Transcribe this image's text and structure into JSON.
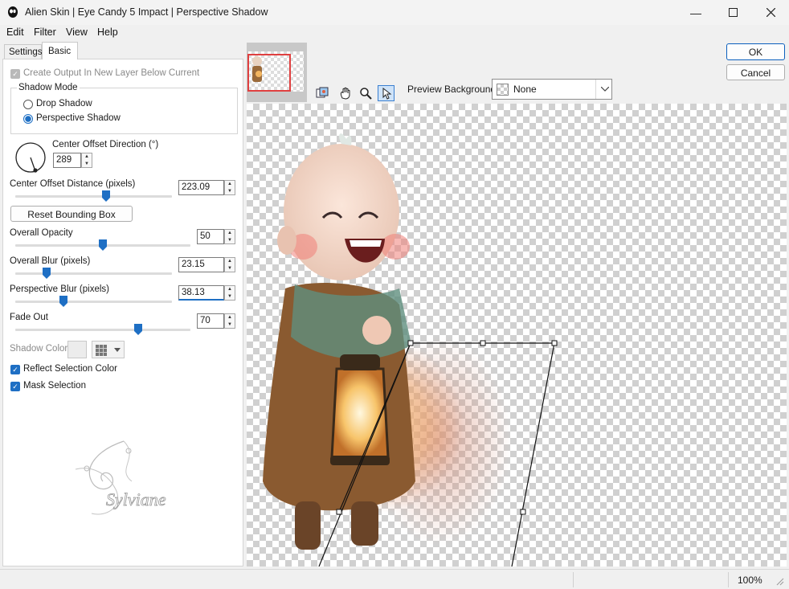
{
  "window": {
    "title": "Alien Skin | Eye Candy 5 Impact | Perspective Shadow"
  },
  "menu": {
    "items": [
      "Edit",
      "Filter",
      "View",
      "Help"
    ]
  },
  "tabs": {
    "settings": "Settings",
    "basic": "Basic"
  },
  "basic": {
    "create_output_label": "Create Output In New Layer Below Current",
    "shadow_mode_title": "Shadow Mode",
    "drop_shadow_label": "Drop Shadow",
    "perspective_shadow_label": "Perspective Shadow",
    "selected_mode": "Perspective Shadow",
    "center_offset_direction": {
      "label": "Center Offset Direction (°)",
      "value": "289"
    },
    "center_offset_distance": {
      "label": "Center Offset Distance (pixels)",
      "value": "223.09",
      "level": 0.58
    },
    "reset_bounding_box_label": "Reset Bounding Box",
    "overall_opacity": {
      "label": "Overall Opacity",
      "value": "50",
      "level": 0.5
    },
    "overall_blur": {
      "label": "Overall Blur (pixels)",
      "value": "23.15",
      "level": 0.2
    },
    "perspective_blur": {
      "label": "Perspective Blur (pixels)",
      "value": "38.13",
      "level": 0.31
    },
    "fade_out": {
      "label": "Fade Out",
      "value": "70",
      "level": 0.7
    },
    "shadow_color_label": "Shadow Color",
    "reflect_selection_color_label": "Reflect Selection Color",
    "mask_selection_label": "Mask Selection",
    "watermark_text": "Sylviane"
  },
  "dialog": {
    "ok_label": "OK",
    "cancel_label": "Cancel",
    "preview_background_label": "Preview Background:",
    "preview_background_value": "None"
  },
  "status": {
    "zoom": "100%"
  },
  "colors": {
    "accent": "#1e6fc4",
    "selection_rect": "#e04040"
  }
}
